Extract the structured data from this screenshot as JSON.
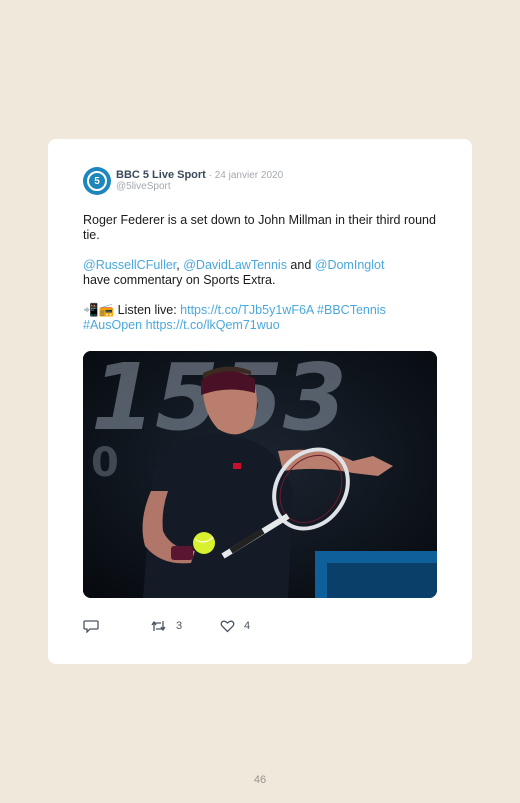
{
  "tweet": {
    "author_name": "BBC 5 Live Sport",
    "separator": " · ",
    "date": "24 janvier 2020",
    "handle": "@5liveSport",
    "avatar_text": "5",
    "line1": "Roger Federer is a set down to John Millman in their third round tie.",
    "mention1": "@RussellCFuller",
    "comma": ", ",
    "mention2": "@DavidLawTennis",
    "and_word": " and ",
    "mention3": "@DomInglot",
    "line2_rest": "have commentary on Sports Extra.",
    "emoji": "📲📻",
    "listen_label": " Listen live: ",
    "link1": "https://t.co/TJb5y1wF6A",
    "hashtag1": "#BBCTennis",
    "hashtag2": "#AusOpen",
    "link2": "https://t.co/lkQem71wuo",
    "photo_scoreboard_text": "1553",
    "retweet_count": "3",
    "like_count": "4"
  },
  "page_number": "46"
}
